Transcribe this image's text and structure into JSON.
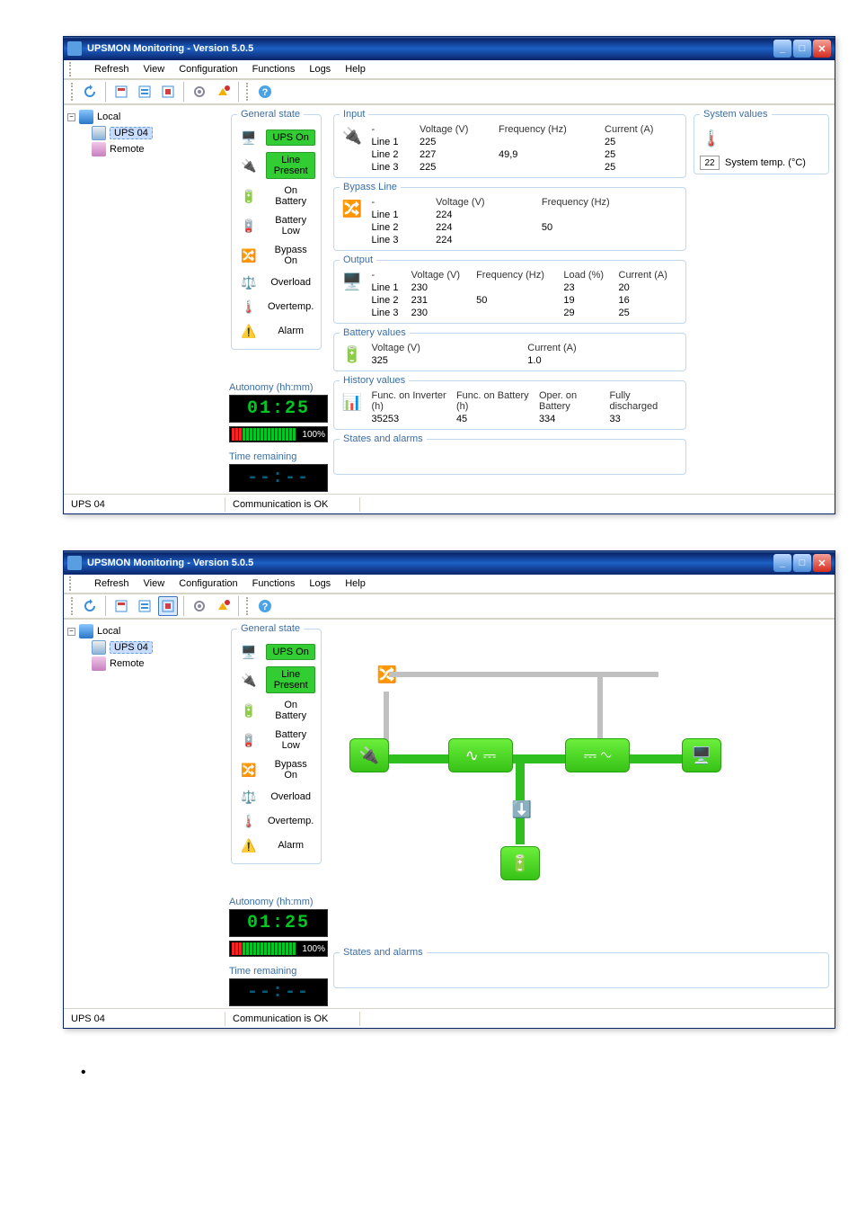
{
  "window_title": "UPSMON Monitoring - Version 5.0.5",
  "menu": [
    "Refresh",
    "View",
    "Configuration",
    "Functions",
    "Logs",
    "Help"
  ],
  "tree": {
    "root": "Local",
    "selected": "UPS 04",
    "remote": "Remote"
  },
  "general_state": {
    "legend": "General state",
    "items": [
      {
        "label": "UPS On",
        "lit": true
      },
      {
        "label": "Line Present",
        "lit": true
      },
      {
        "label": "On Battery",
        "lit": false
      },
      {
        "label": "Battery Low",
        "lit": false
      },
      {
        "label": "Bypass On",
        "lit": false
      },
      {
        "label": "Overload",
        "lit": false
      },
      {
        "label": "Overtemp.",
        "lit": false
      },
      {
        "label": "Alarm",
        "lit": false
      }
    ]
  },
  "autonomy": {
    "head": "Autonomy (hh:mm)",
    "time": "01:25",
    "pct": "100%"
  },
  "time_remaining": {
    "head": "Time remaining",
    "value": "--:--"
  },
  "input": {
    "legend": "Input",
    "cols": [
      "-",
      "Voltage (V)",
      "Frequency (Hz)",
      "Current (A)"
    ],
    "rows": [
      [
        "Line 1",
        "225",
        "",
        "25"
      ],
      [
        "Line 2",
        "227",
        "49,9",
        "25"
      ],
      [
        "Line 3",
        "225",
        "",
        "25"
      ]
    ]
  },
  "bypass": {
    "legend": "Bypass Line",
    "cols": [
      "-",
      "Voltage (V)",
      "Frequency (Hz)"
    ],
    "rows": [
      [
        "Line 1",
        "224",
        ""
      ],
      [
        "Line 2",
        "224",
        "50"
      ],
      [
        "Line 3",
        "224",
        ""
      ]
    ]
  },
  "output": {
    "legend": "Output",
    "cols": [
      "-",
      "Voltage (V)",
      "Frequency (Hz)",
      "Load (%)",
      "Current (A)"
    ],
    "rows": [
      [
        "Line 1",
        "230",
        "",
        "23",
        "20"
      ],
      [
        "Line 2",
        "231",
        "50",
        "19",
        "16"
      ],
      [
        "Line 3",
        "230",
        "",
        "29",
        "25"
      ]
    ]
  },
  "battery": {
    "legend": "Battery values",
    "voltage_h": "Voltage (V)",
    "voltage": "325",
    "current_h": "Current (A)",
    "current": "1.0"
  },
  "history": {
    "legend": "History values",
    "func_inv_h": "Func. on Inverter (h)",
    "func_inv": "35253",
    "func_bat_h": "Func. on Battery (h)",
    "func_bat": "45",
    "oper_bat_h": "Oper. on Battery",
    "oper_bat": "334",
    "fully_h": "Fully discharged",
    "fully": "33"
  },
  "system": {
    "legend": "System values",
    "temp": "22",
    "temp_lbl": "System temp. (°C)"
  },
  "states_alarms": {
    "legend": "States and alarms"
  },
  "status": {
    "left": "UPS 04",
    "mid": "Communication is OK"
  }
}
